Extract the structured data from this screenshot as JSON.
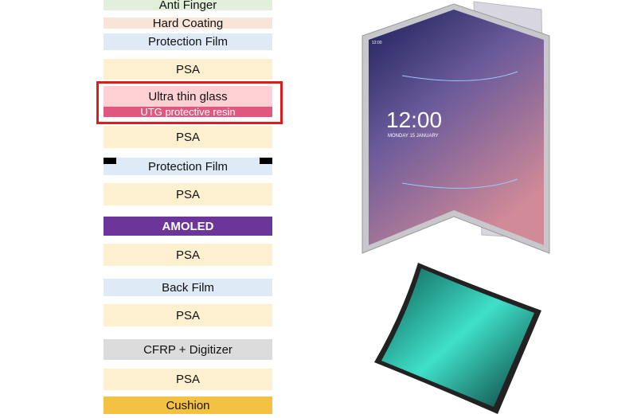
{
  "layers": [
    {
      "label": "Anti Finger",
      "color": "#e2efda"
    },
    {
      "label": "Hard Coating",
      "color": "#f8e5d8"
    },
    {
      "label": "Protection Film",
      "color": "#deeaf5"
    },
    {
      "label": "PSA",
      "color": "#fdf0d0"
    },
    {
      "label": "Ultra thin glass",
      "color": "#ffd0d3"
    },
    {
      "label": "UTG protective resin",
      "color": "#e0587f"
    },
    {
      "label": "PSA",
      "color": "#fdf0d0"
    },
    {
      "label": "Protection Film",
      "color": "#deeaf5"
    },
    {
      "label": "PSA",
      "color": "#fdf0d0"
    },
    {
      "label": "AMOLED",
      "color": "#6b359a"
    },
    {
      "label": "PSA",
      "color": "#fdf0d0"
    },
    {
      "label": "Back Film",
      "color": "#deeaf5"
    },
    {
      "label": "PSA",
      "color": "#fdf0d0"
    },
    {
      "label": "CFRP + Digitizer",
      "color": "#dcdcdc"
    },
    {
      "label": "PSA",
      "color": "#fdf0d0"
    },
    {
      "label": "Cushion",
      "color": "#f4c242"
    }
  ],
  "highlight_color": "#e01b1b",
  "phone": {
    "time": "12:00",
    "date": "MONDAY 15 JANUARY",
    "status_time": "12:00"
  }
}
